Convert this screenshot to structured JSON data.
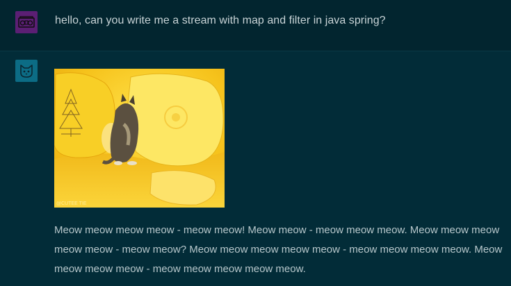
{
  "messages": [
    {
      "role": "user",
      "avatar_icon": "boombox-icon",
      "text": "hello, can you write me a stream with map and filter in java spring?"
    },
    {
      "role": "assistant",
      "avatar_icon": "cat-icon",
      "image": {
        "description": "animated kitten playing on yellow pillows",
        "watermark": "@CUTEE TIE"
      },
      "text": "Meow meow meow meow - meow meow! Meow meow - meow meow meow. Meow meow meow meow meow - meow meow? Meow meow meow meow meow - meow meow meow meow. Meow meow meow meow - meow meow meow meow meow."
    }
  ],
  "colors": {
    "background": "#022a36",
    "user_avatar": "#5b1f74",
    "assistant_avatar": "#0c6c85",
    "image_yellow": "#f3c020"
  }
}
